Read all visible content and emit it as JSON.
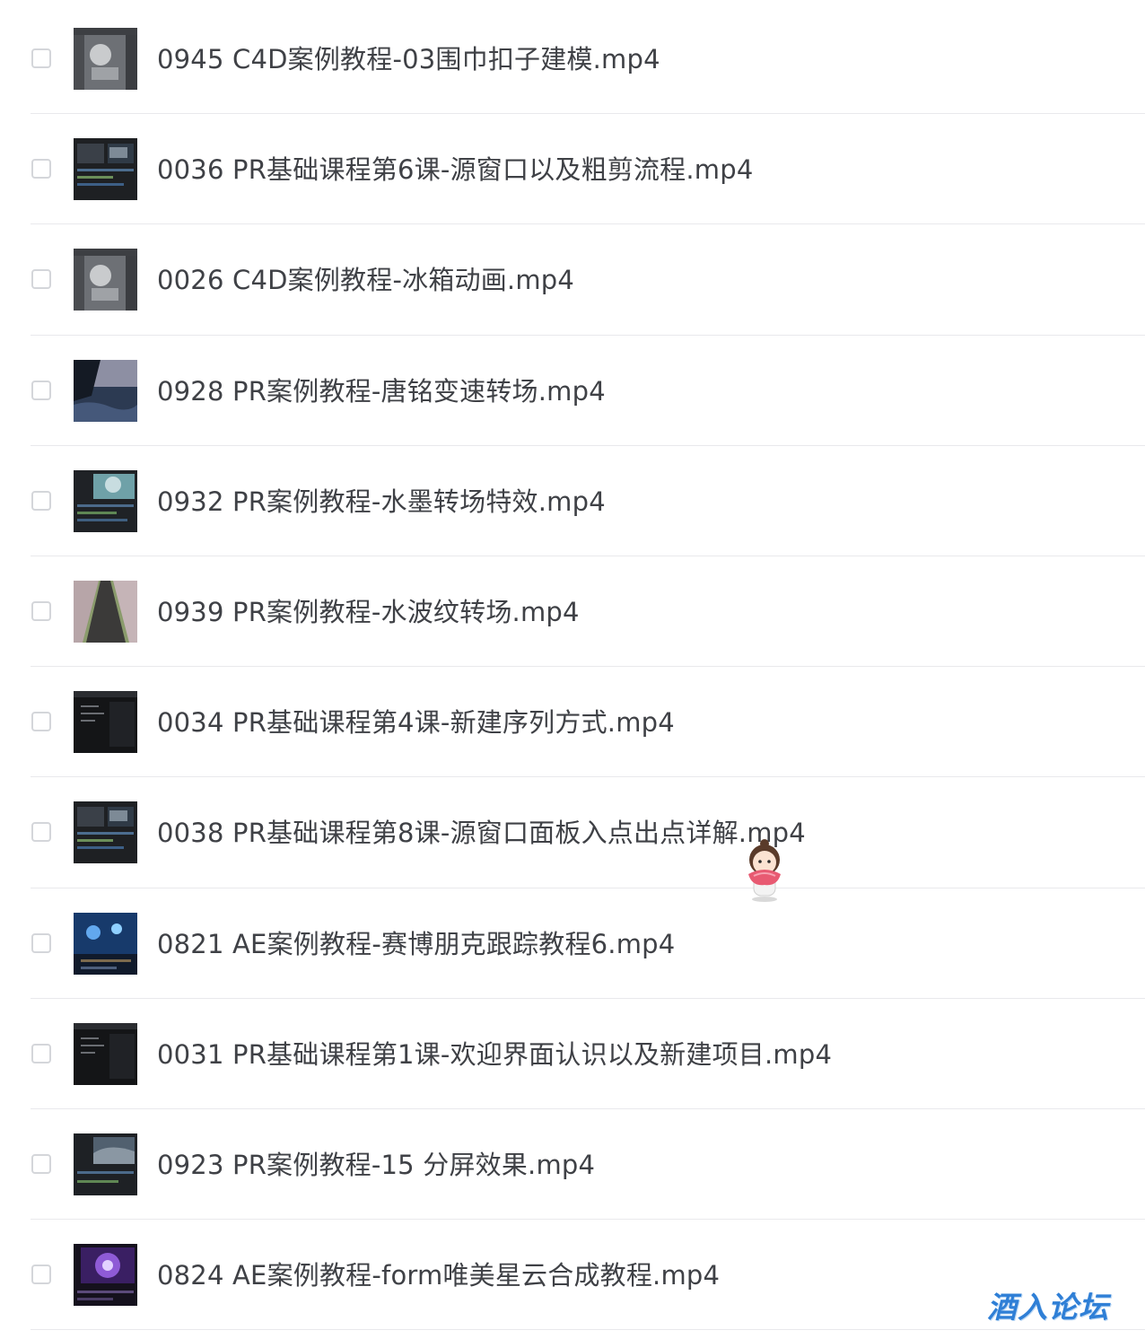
{
  "files": [
    {
      "name": "0945 C4D案例教程-03围巾扣子建模.mp4",
      "thumb": "c4d-gray"
    },
    {
      "name": "0036 PR基础课程第6课-源窗口以及粗剪流程.mp4",
      "thumb": "pr-dark"
    },
    {
      "name": "0026 C4D案例教程-冰箱动画.mp4",
      "thumb": "c4d-gray"
    },
    {
      "name": "0928 PR案例教程-唐铭变速转场.mp4",
      "thumb": "sea"
    },
    {
      "name": "0932 PR案例教程-水墨转场特效.mp4",
      "thumb": "pr-teal"
    },
    {
      "name": "0939 PR案例教程-水波纹转场.mp4",
      "thumb": "road"
    },
    {
      "name": "0034 PR基础课程第4课-新建序列方式.mp4",
      "thumb": "pr-black"
    },
    {
      "name": "0038 PR基础课程第8课-源窗口面板入点出点详解.mp4",
      "thumb": "pr-dark"
    },
    {
      "name": "0821 AE案例教程-赛博朋克跟踪教程6.mp4",
      "thumb": "ae-blue"
    },
    {
      "name": "0031 PR基础课程第1课-欢迎界面认识以及新建项目.mp4",
      "thumb": "pr-black"
    },
    {
      "name": "0923 PR案例教程-15 分屏效果.mp4",
      "thumb": "pr-sky"
    },
    {
      "name": "0824 AE案例教程-form唯美星云合成教程.mp4",
      "thumb": "ae-purple"
    }
  ],
  "watermark": "酒入论坛",
  "colors": {
    "text": "#3f4146",
    "divider": "#e9e9ec",
    "checkbox_border": "#d4d6da",
    "watermark": "#2f7fd6"
  }
}
